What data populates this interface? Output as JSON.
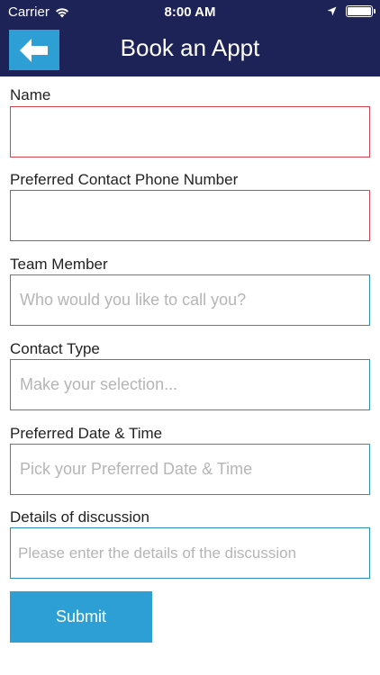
{
  "status_bar": {
    "carrier": "Carrier",
    "time": "8:00 AM"
  },
  "header": {
    "title": "Book an Appt",
    "back_icon": "arrow-left-icon"
  },
  "form": {
    "name": {
      "label": "Name",
      "value": "",
      "placeholder": ""
    },
    "phone": {
      "label": "Preferred Contact Phone Number",
      "value": "",
      "placeholder": ""
    },
    "team_member": {
      "label": "Team Member",
      "placeholder": "Who would you like to call you?"
    },
    "contact_type": {
      "label": "Contact Type",
      "placeholder": "Make your selection..."
    },
    "date_time": {
      "label": "Preferred Date & Time",
      "placeholder": "Pick your Preferred Date & Time"
    },
    "details": {
      "label": "Details of discussion",
      "placeholder": "Please enter the details of the discussion"
    },
    "submit_label": "Submit"
  },
  "colors": {
    "header_bg": "#1d2357",
    "accent": "#2d9fd4",
    "field_border": "#2b8fb2",
    "invalid_border": "#d9434f"
  }
}
